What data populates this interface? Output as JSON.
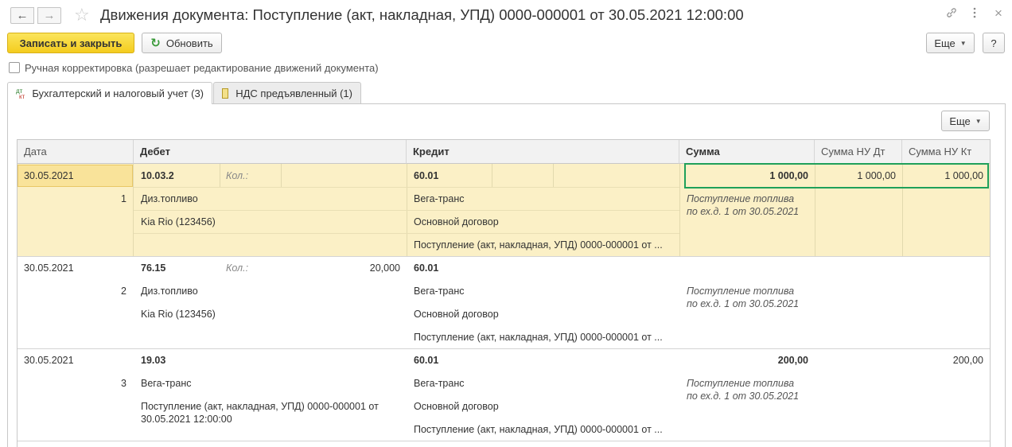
{
  "window": {
    "title": "Движения документа: Поступление (акт, накладная, УПД) 0000-000001 от 30.05.2021 12:00:00",
    "back_glyph": "←",
    "forward_glyph": "→",
    "favorite_glyph": "☆",
    "link_glyph": "🔗",
    "menu_glyph": "⋮",
    "close_glyph": "×"
  },
  "toolbar": {
    "save_close_label": "Записать и закрыть",
    "refresh_label": "Обновить",
    "refresh_glyph": "↻",
    "more_label": "Еще",
    "help_label": "?"
  },
  "manual_correction": {
    "label": "Ручная корректировка (разрешает редактирование движений документа)",
    "checked": false
  },
  "tabs": [
    {
      "label": "Бухгалтерский и налоговый учет (3)",
      "icon_top": "дт",
      "icon_bottom": "кт",
      "active": true
    },
    {
      "label": "НДС предъявленный (1)",
      "icon": "document-icon",
      "active": false
    }
  ],
  "table": {
    "more_label": "Еще",
    "columns": {
      "date": "Дата",
      "debit": "Дебет",
      "credit": "Кредит",
      "sum": "Сумма",
      "sum_nu_dt": "Сумма НУ Дт",
      "sum_nu_kt": "Сумма НУ Кт"
    },
    "rows": [
      {
        "date": "30.05.2021",
        "num": "1",
        "debit_account": "10.03.2",
        "qty_label": "Кол.:",
        "qty_value": "",
        "debit_sub1": "Диз.топливо",
        "debit_sub2": "Kia Rio (123456)",
        "debit_sub3": "",
        "credit_account": "60.01",
        "credit_sub1": "Вега-транс",
        "credit_sub2": "Основной договор",
        "credit_sub3": "Поступление (акт, накладная, УПД) 0000-000001 от ...",
        "sum": "1 000,00",
        "content_line1": "Поступление топлива",
        "content_line2": "по ех.д. 1 от 30.05.2021",
        "sum_nu_dt": "1 000,00",
        "sum_nu_kt": "1 000,00"
      },
      {
        "date": "30.05.2021",
        "num": "2",
        "debit_account": "76.15",
        "qty_label": "Кол.:",
        "qty_value": "20,000",
        "debit_sub1": "Диз.топливо",
        "debit_sub2": "Kia Rio (123456)",
        "debit_sub3": "",
        "credit_account": "60.01",
        "credit_sub1": "Вега-транс",
        "credit_sub2": "Основной договор",
        "credit_sub3": "Поступление (акт, накладная, УПД) 0000-000001 от ...",
        "sum": "",
        "content_line1": "Поступление топлива",
        "content_line2": "по ех.д. 1 от 30.05.2021",
        "sum_nu_dt": "",
        "sum_nu_kt": ""
      },
      {
        "date": "30.05.2021",
        "num": "3",
        "debit_account": "19.03",
        "qty_label": "",
        "qty_value": "",
        "debit_sub1": "Вега-транс",
        "debit_sub2": "Поступление (акт, накладная, УПД) 0000-000001 от",
        "debit_sub3": "30.05.2021 12:00:00",
        "credit_account": "60.01",
        "credit_sub1": "Вега-транс",
        "credit_sub2": "Основной договор",
        "credit_sub3": "Поступление (акт, накладная, УПД) 0000-000001 от ...",
        "sum": "200,00",
        "content_line1": "Поступление топлива",
        "content_line2": "по ех.д. 1 от 30.05.2021",
        "sum_nu_dt": "",
        "sum_nu_kt": "200,00"
      }
    ]
  },
  "colors": {
    "accent_yellow": "#f4cc1e",
    "selected_row": "#fbf0c6",
    "highlight_box": "#1fa05a"
  }
}
